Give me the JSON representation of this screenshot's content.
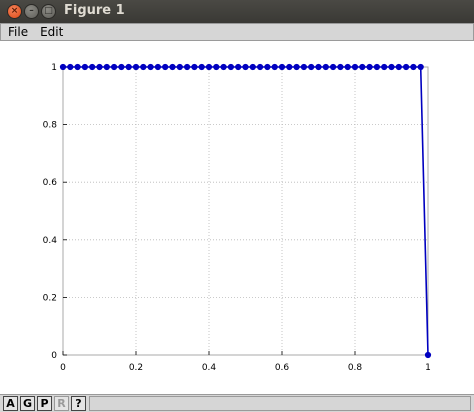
{
  "window": {
    "title": "Figure 1"
  },
  "menu": {
    "items": [
      "File",
      "Edit"
    ]
  },
  "toolbar": {
    "buttons": [
      "A",
      "G",
      "P",
      "R",
      "?"
    ]
  },
  "colors": {
    "series": "#0000c0",
    "grid": "#b8b8b8",
    "axes": "#000000"
  },
  "chart_data": {
    "type": "line",
    "title": "",
    "xlabel": "",
    "ylabel": "",
    "xlim": [
      0,
      1
    ],
    "ylim": [
      0,
      1
    ],
    "grid": true,
    "x_ticks": [
      "0",
      "0.2",
      "0.4",
      "0.6",
      "0.8",
      "1"
    ],
    "y_ticks": [
      "0",
      "0.2",
      "0.4",
      "0.6",
      "0.8",
      "1"
    ],
    "series": [
      {
        "x": [
          0,
          0.98,
          1
        ],
        "y": [
          1,
          1,
          0
        ],
        "markers_x": [
          0,
          0.02,
          0.04,
          0.06,
          0.08,
          0.1,
          0.12,
          0.14,
          0.16,
          0.18,
          0.2,
          0.22,
          0.24,
          0.26,
          0.28,
          0.3,
          0.32,
          0.34,
          0.36,
          0.38,
          0.4,
          0.42,
          0.44,
          0.46,
          0.48,
          0.5,
          0.52,
          0.54,
          0.56,
          0.58,
          0.6,
          0.62,
          0.64,
          0.66,
          0.68,
          0.7,
          0.72,
          0.74,
          0.76,
          0.78,
          0.8,
          0.82,
          0.84,
          0.86,
          0.88,
          0.9,
          0.92,
          0.94,
          0.96,
          0.98,
          1
        ],
        "markers_y": [
          1,
          1,
          1,
          1,
          1,
          1,
          1,
          1,
          1,
          1,
          1,
          1,
          1,
          1,
          1,
          1,
          1,
          1,
          1,
          1,
          1,
          1,
          1,
          1,
          1,
          1,
          1,
          1,
          1,
          1,
          1,
          1,
          1,
          1,
          1,
          1,
          1,
          1,
          1,
          1,
          1,
          1,
          1,
          1,
          1,
          1,
          1,
          1,
          1,
          1,
          0
        ]
      }
    ]
  }
}
